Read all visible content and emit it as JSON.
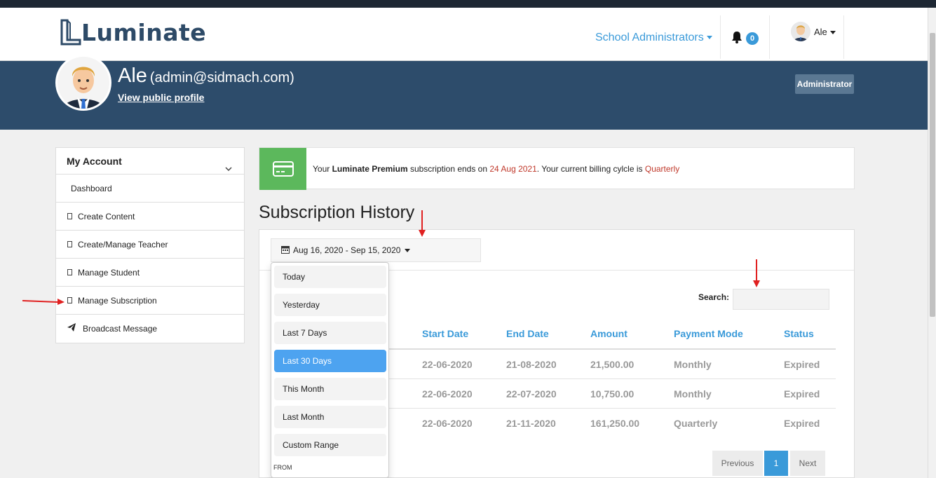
{
  "brand": {
    "logo_text": "Luminate"
  },
  "navbar": {
    "role_menu": "School Administrators",
    "notifications_count": "0",
    "user_name": "Ale"
  },
  "profile": {
    "name": "Ale",
    "email": "(admin@sidmach.com)",
    "public_link": "View public profile",
    "role_badge": "Administrator"
  },
  "sidebar": {
    "title": "My Account",
    "items": [
      {
        "label": "Dashboard",
        "icon": "none"
      },
      {
        "label": "Create Content",
        "icon": "square-icon"
      },
      {
        "label": "Create/Manage Teacher",
        "icon": "square-icon"
      },
      {
        "label": "Manage Student",
        "icon": "square-icon"
      },
      {
        "label": "Manage Subscription",
        "icon": "square-icon"
      },
      {
        "label": "Broadcast Message",
        "icon": "paper-plane-icon"
      }
    ]
  },
  "alert": {
    "prefix": "Your ",
    "plan": "Luminate Premium",
    "mid": " subscription ends on ",
    "end_date": "24 Aug 2021",
    "mid2": ". Your current billing cylcle is ",
    "cycle": "Quarterly"
  },
  "history": {
    "title": "Subscription History",
    "date_range": "Aug 16, 2020 - Sep 15, 2020",
    "search_label": "Search:",
    "search_value": "",
    "columns": [
      "Start Date",
      "End Date",
      "Amount",
      "Payment Mode",
      "Status"
    ],
    "rows": [
      [
        "22-06-2020",
        "21-08-2020",
        "21,500.00",
        "Monthly",
        "Expired"
      ],
      [
        "22-06-2020",
        "22-07-2020",
        "10,750.00",
        "Monthly",
        "Expired"
      ],
      [
        "22-06-2020",
        "21-11-2020",
        "161,250.00",
        "Quarterly",
        "Expired"
      ]
    ],
    "pagination": {
      "previous": "Previous",
      "current": "1",
      "next": "Next"
    }
  },
  "date_dropdown": {
    "options": [
      "Today",
      "Yesterday",
      "Last 7 Days",
      "Last 30 Days",
      "This Month",
      "Last Month",
      "Custom Range"
    ],
    "selected": "Last 30 Days",
    "from_label": "FROM"
  },
  "colors": {
    "accent": "#3a9ad9",
    "banner": "#2d4c6b",
    "success": "#5cb85c",
    "danger": "#c0392b",
    "annotation_arrow": "#e02020"
  }
}
